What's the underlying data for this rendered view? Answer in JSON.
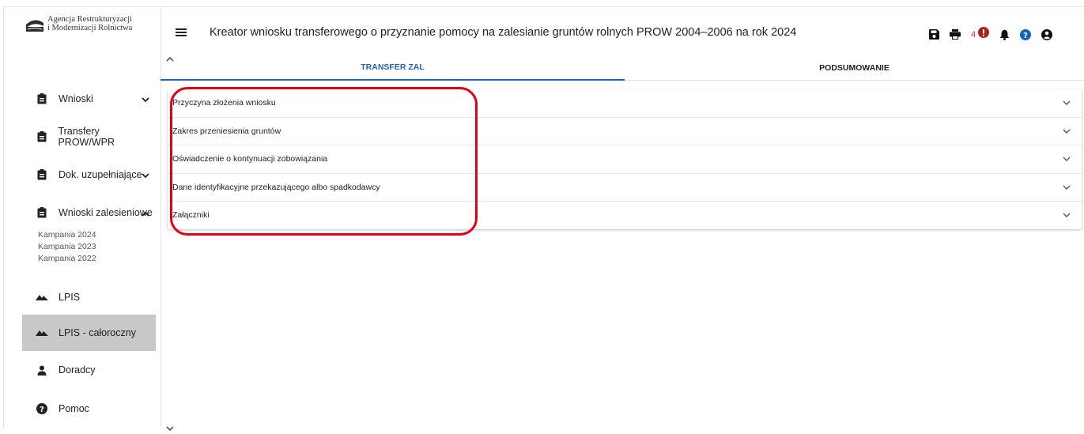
{
  "logo": {
    "line1": "Agencja Restrukturyzacji",
    "line2": "i Modernizacji Rolnictwa"
  },
  "header": {
    "title": "Kreator wniosku transferowego o przyznanie pomocy na zalesianie gruntów rolnych PROW 2004–2006 na rok 2024",
    "error_count": "4"
  },
  "sidebar": {
    "items": [
      {
        "label": "Wnioski",
        "icon": "clipboard-icon"
      },
      {
        "label": "Transfery PROW/WPR",
        "icon": "clipboard-icon"
      },
      {
        "label": "Dok. uzupełniające",
        "icon": "clipboard-icon"
      },
      {
        "label": "Wnioski zalesieniowe",
        "icon": "clipboard-icon"
      },
      {
        "label": "LPIS",
        "icon": "mountain-icon"
      },
      {
        "label": "LPIS - całoroczny",
        "icon": "mountain-icon"
      },
      {
        "label": "Doradcy",
        "icon": "person-icon"
      },
      {
        "label": "Pomoc",
        "icon": "help-icon"
      }
    ],
    "subitems": [
      "Kampania 2024",
      "Kampania 2023",
      "Kampania 2022"
    ]
  },
  "tabs": [
    "TRANSFER ZAL",
    "PODSUMOWANIE"
  ],
  "sections": [
    "Przyczyna złożenia wniosku",
    "Zakres przeniesienia gruntów",
    "Oświadczenie o kontynuacji zobowiązania",
    "Dane identyfikacyjne przekazującego albo spadkodawcy",
    "Załączniki"
  ],
  "colors": {
    "accent": "#1e63c2",
    "error": "#d32f2f",
    "highlight": "#e60012",
    "active_nav": "#c8c8c8",
    "icon_blue": "#1565c0"
  }
}
